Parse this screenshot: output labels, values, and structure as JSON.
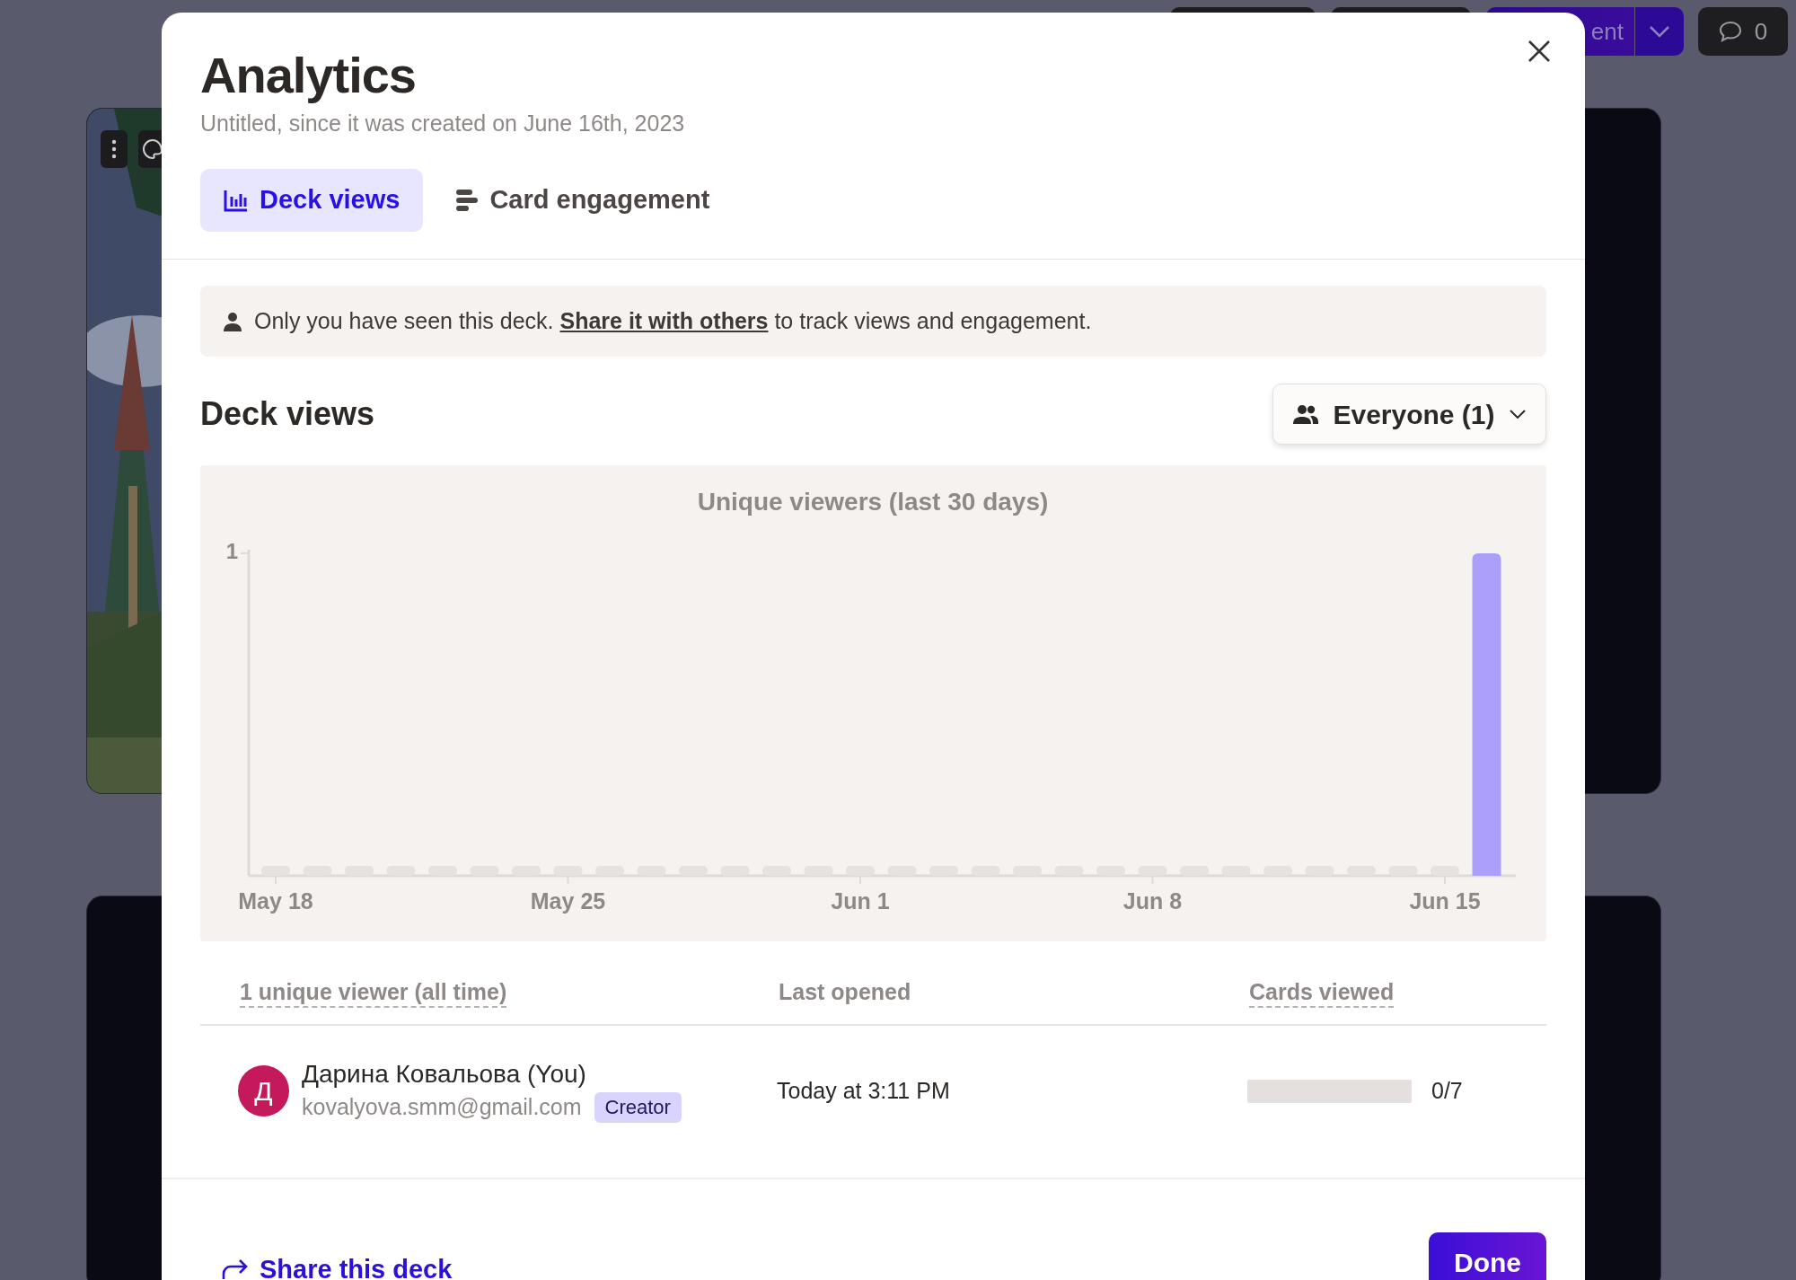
{
  "toolbar": {
    "primary_button_label": "ent",
    "comment_count": "0"
  },
  "dialog": {
    "title": "Analytics",
    "subtitle": "Untitled, since it was created on June 16th, 2023",
    "tabs": [
      {
        "label": "Deck views",
        "selected": true
      },
      {
        "label": "Card engagement",
        "selected": false
      }
    ],
    "notice": {
      "before": "Only you have seen this deck. ",
      "link": "Share it with others",
      "after": " to track views and engagement."
    },
    "section_title": "Deck views",
    "audience_filter": "Everyone (1)",
    "chart": {
      "title": "Unique viewers (last 30 days)",
      "y_axis_label": "1",
      "x_axis_labels": [
        "May 18",
        "May 25",
        "Jun 1",
        "Jun 8",
        "Jun 15"
      ]
    },
    "table": {
      "columns": [
        {
          "label": "1 unique viewer (all time)",
          "underlined": true
        },
        {
          "label": "Last opened",
          "underlined": false
        },
        {
          "label": "Cards viewed",
          "underlined": true
        }
      ],
      "rows": [
        {
          "avatar_letter": "Д",
          "name": "Дарина Ковальова (You)",
          "email": "kovalyova.smm@gmail.com",
          "role": "Creator",
          "last_opened": "Today at 3:11 PM",
          "level": 0,
          "cards_viewed": "0/7"
        }
      ]
    },
    "share_link": "Share this deck",
    "done_button": "Done"
  }
}
